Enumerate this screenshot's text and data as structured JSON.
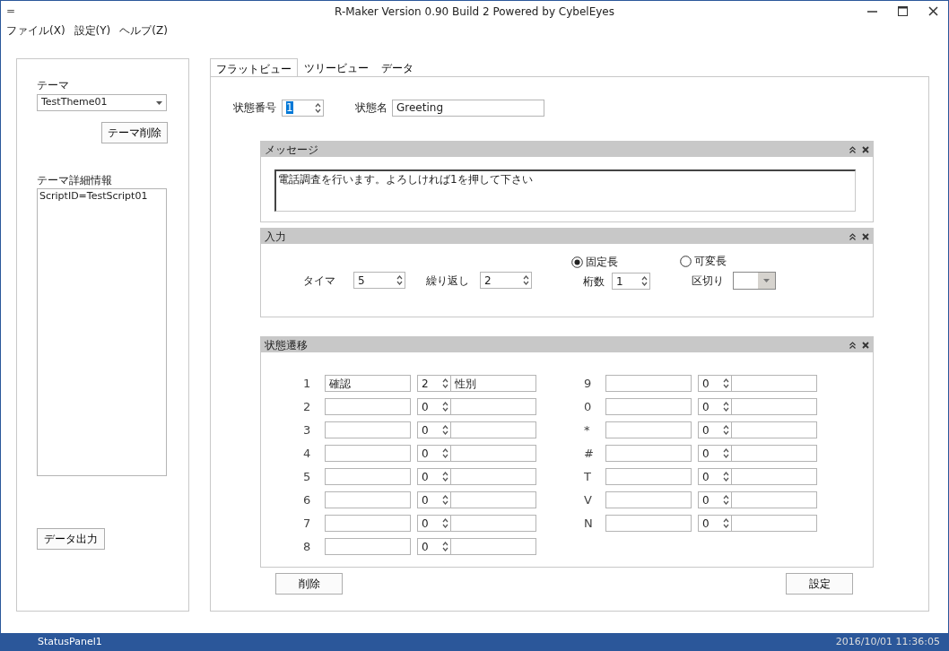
{
  "window": {
    "system_icon": "=",
    "title": "R-Maker Version 0.90 Build 2 Powered by CybelEyes"
  },
  "menu": [
    "ファイル(X)",
    "設定(Y)",
    "ヘルプ(Z)"
  ],
  "left_panel": {
    "theme_label": "テーマ",
    "theme_value": "TestTheme01",
    "delete_button": "テーマ削除",
    "details_label": "テーマ詳細情報",
    "details_text": "ScriptID=TestScript01",
    "export_button": "データ出力"
  },
  "tabs": [
    {
      "label": "フラットビュー",
      "selected": true
    },
    {
      "label": "ツリービュー",
      "selected": false
    },
    {
      "label": "データ",
      "selected": false
    }
  ],
  "state": {
    "number_label": "状態番号",
    "number": "1",
    "name_label": "状態名",
    "name": "Greeting"
  },
  "message_panel": {
    "title": "メッセージ",
    "text": "電話調査を行います。よろしければ1を押して下さい"
  },
  "input_panel": {
    "title": "入力",
    "timer_label": "タイマ",
    "timer": "5",
    "repeat_label": "繰り返し",
    "repeat": "2",
    "modes": [
      {
        "kind": "spinner",
        "label": "固定長",
        "selected": true,
        "sub_label": "桁数",
        "value": "1"
      },
      {
        "kind": "dropdown",
        "label": "可変長",
        "selected": false,
        "sub_label": "区切り"
      }
    ]
  },
  "transition_panel": {
    "title": "状態遷移",
    "columns": [
      [
        {
          "key": "1",
          "name": "確認",
          "number": "2",
          "target": "性別"
        },
        {
          "key": "2",
          "number": "0"
        },
        {
          "key": "3",
          "number": "0"
        },
        {
          "key": "4",
          "number": "0"
        },
        {
          "key": "5",
          "number": "0"
        },
        {
          "key": "6",
          "number": "0"
        },
        {
          "key": "7",
          "number": "0"
        },
        {
          "key": "8",
          "number": "0"
        }
      ],
      [
        {
          "key": "9",
          "number": "0"
        },
        {
          "key": "0",
          "number": "0"
        },
        {
          "key": "*",
          "number": "0"
        },
        {
          "key": "#",
          "number": "0"
        },
        {
          "key": "T",
          "number": "0"
        },
        {
          "key": "V",
          "number": "0"
        },
        {
          "key": "N",
          "number": "0"
        }
      ]
    ]
  },
  "buttons": {
    "delete": "削除",
    "apply": "設定"
  },
  "status_bar": {
    "panel": "StatusPanel1",
    "datetime": "2016/10/01 11:36:05"
  }
}
